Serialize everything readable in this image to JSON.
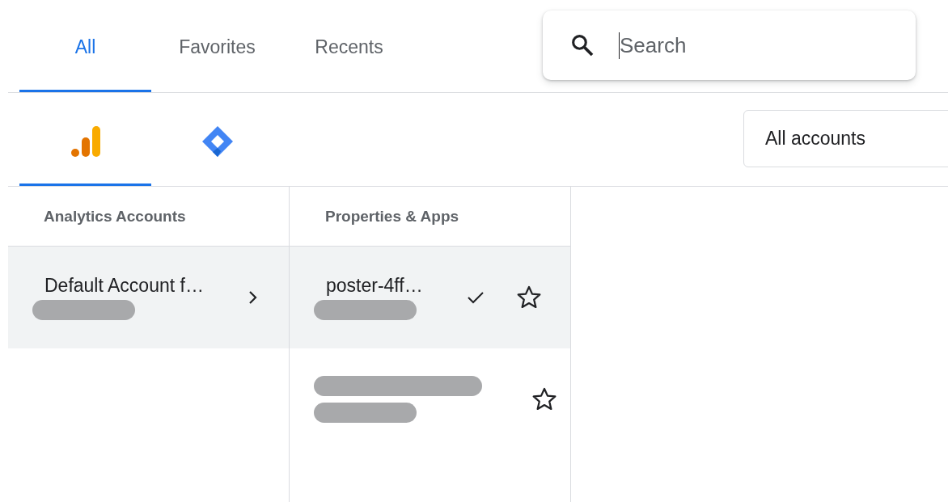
{
  "tabs": [
    {
      "label": "All",
      "selected": true
    },
    {
      "label": "Favorites",
      "selected": false
    },
    {
      "label": "Recents",
      "selected": false
    }
  ],
  "search": {
    "placeholder": "Search"
  },
  "product_tabs": [
    {
      "kind": "analytics",
      "selected": true
    },
    {
      "kind": "tag-manager",
      "selected": false
    }
  ],
  "account_filter": {
    "value": "All accounts"
  },
  "columns": [
    {
      "heading": "Analytics Accounts",
      "items": [
        {
          "kind": "account",
          "name": "Default Account f…",
          "selected": true
        }
      ]
    },
    {
      "heading": "Properties & Apps",
      "items": [
        {
          "kind": "property",
          "name": "poster-4ff…",
          "selected": true,
          "starred": false
        },
        {
          "kind": "redacted",
          "selected": false,
          "starred": false
        }
      ]
    }
  ]
}
